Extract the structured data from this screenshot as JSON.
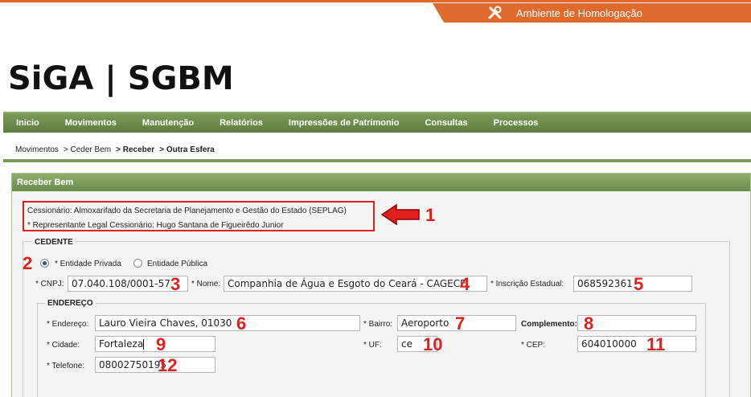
{
  "env": {
    "label": "Ambiente de Homologação",
    "icon": "wrench-icon"
  },
  "logo": {
    "text": "SiGA | SGBM"
  },
  "nav": {
    "items": [
      "Inicio",
      "Movimentos",
      "Manutenção",
      "Relatórios",
      "Impressões de Patrimonio",
      "Consultas",
      "Processos"
    ]
  },
  "breadcrumb": {
    "items": [
      "Movimentos",
      "> Ceder Bem",
      "> Receber",
      "> Outra Esfera"
    ]
  },
  "panel": {
    "title": "Receber Bem",
    "cessionario": "Cessionário: Almoxarifado da Secretaria de Planejamento e Gestão do Estado (SEPLAG)",
    "representante": "* Representante Legal Cessionário: Hugo Santana de Figueirêdo Junior"
  },
  "cedente": {
    "legend": "CEDENTE",
    "radio_privada": "* Entidade Privada",
    "radio_publica": "Entidade Pública",
    "cnpj_label": "* CNPJ:",
    "cnpj_value": "07.040.108/0001-57",
    "nome_label": "* Nome:",
    "nome_value": "Companhia de Água e Esgoto do Ceará - CAGECE",
    "ie_label": "* Inscrição Estadual:",
    "ie_value": "068592361"
  },
  "endereco": {
    "legend": "ENDEREÇO",
    "endereco_label": "* Endereço:",
    "endereco_value": "Lauro Vieira Chaves, 01030",
    "bairro_label": "* Bairro:",
    "bairro_value": "Aeroporto",
    "complemento_label": "Complemento:",
    "complemento_value": "",
    "cidade_label": "* Cidade:",
    "cidade_value": "Fortaleza",
    "uf_label": "* UF:",
    "uf_value": "ce",
    "cep_label": "* CEP:",
    "cep_value": "604010000",
    "telefone_label": "* Telefone:",
    "telefone_value": "08002750195"
  },
  "annotations": [
    "1",
    "2",
    "3",
    "4",
    "5",
    "6",
    "7",
    "8",
    "9",
    "10",
    "11",
    "12"
  ],
  "colors": {
    "accent_orange": "#e06a2c",
    "nav_green": "#6c8b4b",
    "annotation_red": "#e0201c"
  }
}
